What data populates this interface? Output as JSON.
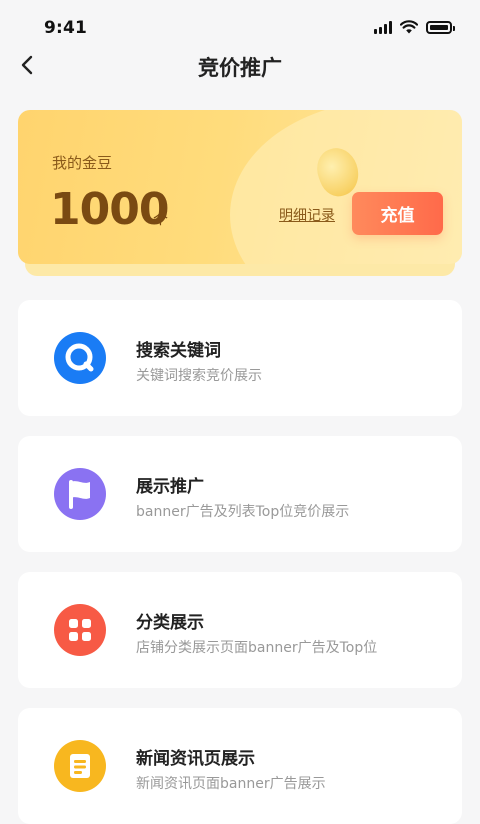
{
  "status_bar": {
    "time": "9:41"
  },
  "header": {
    "title": "竞价推广"
  },
  "gold": {
    "label": "我的金豆",
    "amount": "1000",
    "unit": "个",
    "detail_link": "明细记录",
    "recharge_label": "充值"
  },
  "items": [
    {
      "name": "搜索关键词",
      "desc": "关键词搜索竞价展示",
      "icon": "search-icon",
      "color": "#1a7cf5"
    },
    {
      "name": "展示推广",
      "desc": "banner广告及列表Top位竞价展示",
      "icon": "flag-icon",
      "color": "#8a72f2"
    },
    {
      "name": "分类展示",
      "desc": "店铺分类展示页面banner广告及Top位",
      "icon": "grid-icon",
      "color": "#f75a45"
    },
    {
      "name": "新闻资讯页展示",
      "desc": "新闻资讯页面banner广告展示",
      "icon": "document-icon",
      "color": "#f8b71f"
    }
  ]
}
